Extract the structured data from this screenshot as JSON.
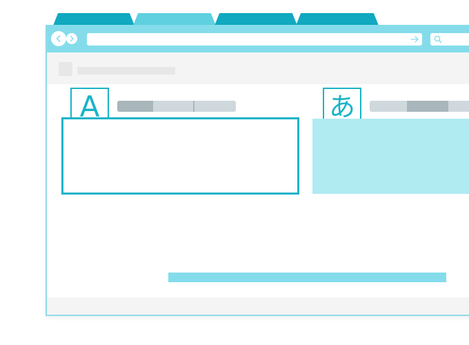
{
  "browser": {
    "tabs": [
      {
        "id": "tab-1",
        "active": false,
        "color": "#10a9c0"
      },
      {
        "id": "tab-2",
        "active": true,
        "color": "#5fd0e0"
      },
      {
        "id": "tab-3",
        "active": false,
        "color": "#10a9c0"
      },
      {
        "id": "tab-4",
        "active": false,
        "color": "#10a9c0"
      }
    ],
    "toolbar": {
      "color": "#84dceb",
      "back_icon": "chevron-left-icon",
      "forward_icon": "chevron-right-icon",
      "go_icon": "arrow-right-icon",
      "search_icon": "search-icon"
    }
  },
  "translator": {
    "source": {
      "badge": "A"
    },
    "target": {
      "badge": "あ"
    }
  },
  "colors": {
    "accent": "#19b3c7",
    "output_fill": "#b1ebf2",
    "placeholder_gray": "#cfd8dc",
    "placeholder_dark": "#a9b6bb"
  }
}
